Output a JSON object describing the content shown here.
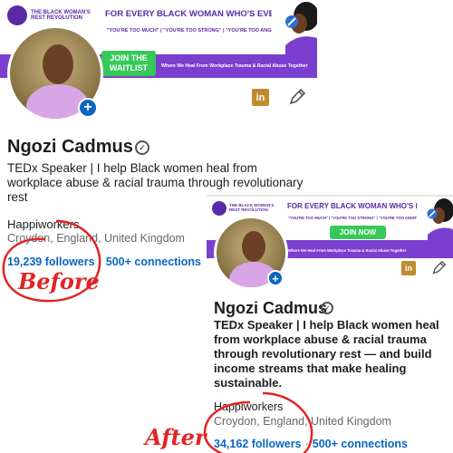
{
  "before": {
    "banner": {
      "logo_text": "THE BLACK WOMAN'S REST REVOLUTION",
      "headline": "FOR EVERY BLACK WOMAN WHO'S EVER BEEN TOLD:",
      "quotes": "\"YOU'RE TOO MUCH\" | \"YOU'RE TOO STRONG\" | \"YOU'RE TOO ANGRY\"",
      "cta_label": "JOIN THE",
      "cta_label_2": "WAITLIST",
      "tagline": "Where We Heal From Workplace Trauma & Racial Abuse Together"
    },
    "add_photo_icon": "+",
    "linkedin_icon": "in",
    "edit_icon": "pencil",
    "name": "Ngozi Cadmus",
    "headline": "TEDx Speaker | I help Black women heal from workplace abuse & racial trauma through revolutionary rest",
    "company": "Happiworkers",
    "location": "Croydon, England, United Kingdom",
    "followers": "19,239 followers",
    "connections": "500+ connections",
    "label": "Before"
  },
  "after": {
    "banner": {
      "logo_text": "THE BLACK WOMAN'S REST REVOLUTION",
      "headline": "FOR EVERY BLACK WOMAN WHO'S EVER BEEN TOLD:",
      "quotes": "\"YOU'RE TOO MUCH\" | \"YOU'RE TOO STRONG\" | \"YOU'RE TOO ANGRY\"",
      "cta_label": "JOIN NOW",
      "tagline": "Where We Heal From Workplace Trauma & Racial Abuse Together"
    },
    "add_photo_icon": "+",
    "linkedin_icon": "in",
    "edit_icon": "pencil",
    "name": "Ngozi Cadmus",
    "headline": "TEDx Speaker | I help Black women heal from workplace abuse & racial trauma through revolutionary rest — and build income streams that make healing sustainable.",
    "company": "Happiworkers",
    "location": "Croydon, England, United Kingdom",
    "followers": "34,162 followers",
    "connections": "500+ connections",
    "label": "After"
  },
  "colors": {
    "brand_purple": "#7b3fcf",
    "cta_green": "#36c95a",
    "link_blue": "#0a66c2",
    "annotation_red": "#e32424",
    "linkedin_gold": "#c08a2f"
  }
}
